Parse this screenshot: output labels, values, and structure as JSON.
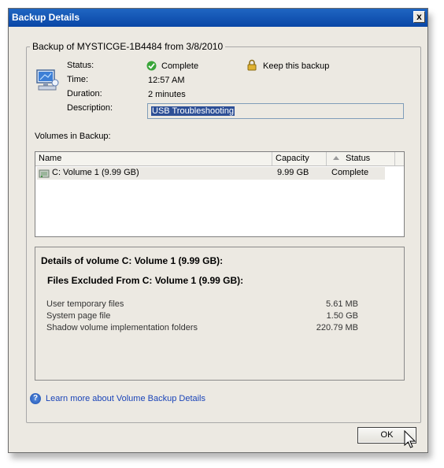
{
  "window": {
    "title": "Backup Details",
    "close_glyph": "x"
  },
  "backup": {
    "group_title": "Backup of MYSTICGE-1B4484 from 3/8/2010",
    "status_label": "Status:",
    "status_value": "Complete",
    "keep_label": "Keep this backup",
    "time_label": "Time:",
    "time_value": "12:57 AM",
    "duration_label": "Duration:",
    "duration_value": "2 minutes",
    "description_label": "Description:",
    "description_value": "USB Troubleshooting"
  },
  "volumes": {
    "section_label": "Volumes in Backup:",
    "columns": {
      "name": "Name",
      "capacity": "Capacity",
      "status": "Status"
    },
    "rows": [
      {
        "name": "C: Volume 1 (9.99 GB)",
        "capacity": "9.99 GB",
        "status": "Complete"
      }
    ]
  },
  "details": {
    "title": "Details of volume C: Volume 1 (9.99 GB):",
    "excluded_title": "Files Excluded From C: Volume 1 (9.99 GB):",
    "items": [
      {
        "name": "User temporary files",
        "size": "5.61 MB"
      },
      {
        "name": "System page file",
        "size": "1.50 GB"
      },
      {
        "name": "Shadow volume implementation folders",
        "size": "220.79 MB"
      }
    ]
  },
  "help": {
    "link_text": "Learn more about Volume Backup Details"
  },
  "footer": {
    "ok_label": "OK"
  },
  "icons": [
    "computer-icon",
    "check-icon",
    "lock-icon",
    "drive-icon",
    "sort-up-icon",
    "help-icon",
    "cursor-icon"
  ]
}
